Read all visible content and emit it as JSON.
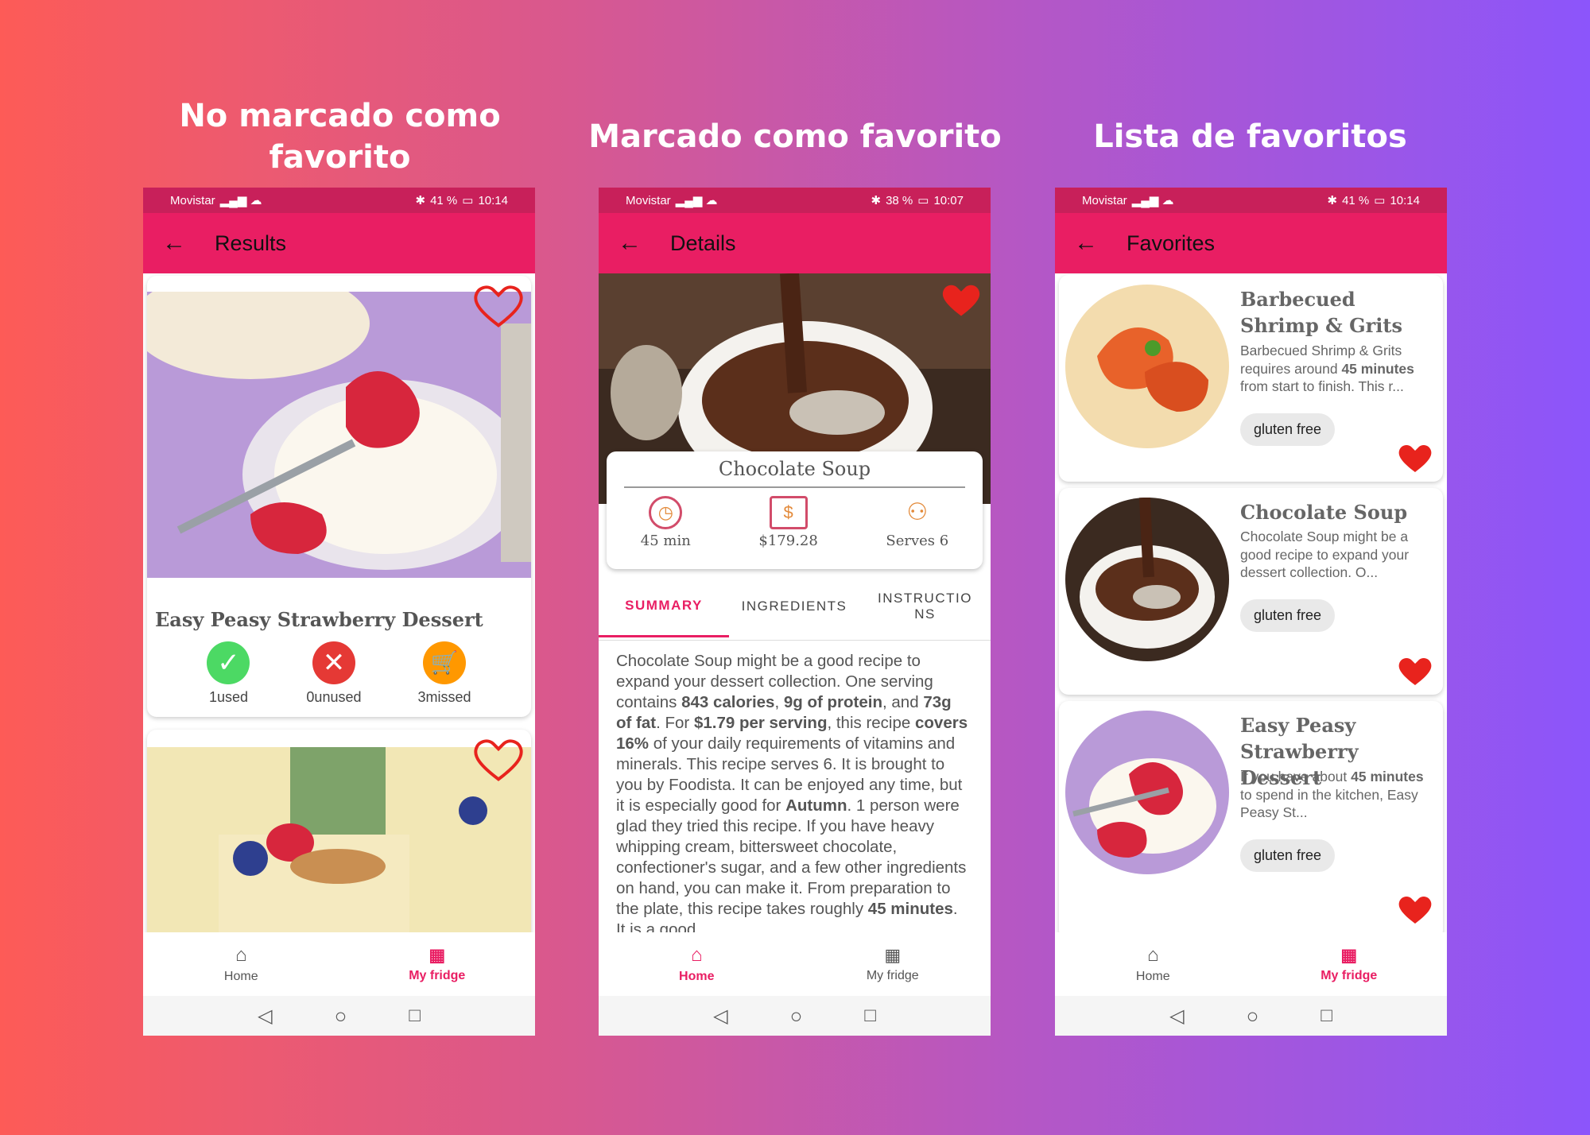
{
  "captions": [
    "No marcado como favorito",
    "Marcado como favorito",
    "Lista de favoritos"
  ],
  "status": [
    {
      "carrier": "Movistar",
      "battery": "41 %",
      "time": "10:14"
    },
    {
      "carrier": "Movistar",
      "battery": "38 %",
      "time": "10:07"
    },
    {
      "carrier": "Movistar",
      "battery": "41 %",
      "time": "10:14"
    }
  ],
  "results": {
    "title": "Results",
    "card_title": "Easy Peasy Strawberry Dessert",
    "used": "1used",
    "unused": "0unused",
    "missed": "3missed"
  },
  "details": {
    "title": "Details",
    "recipe_name": "Chocolate Soup",
    "time": "45 min",
    "price": "$179.28",
    "serves": "Serves 6",
    "tabs": [
      "SUMMARY",
      "INGREDIENTS",
      "INSTRUCTIONS"
    ],
    "summary_parts": [
      {
        "t": "Chocolate Soup might be a good recipe to expand your dessert collection. One serving contains ",
        "b": false
      },
      {
        "t": "843 calories",
        "b": true
      },
      {
        "t": ", ",
        "b": false
      },
      {
        "t": "9g of protein",
        "b": true
      },
      {
        "t": ", and ",
        "b": false
      },
      {
        "t": "73g of fat",
        "b": true
      },
      {
        "t": ". For ",
        "b": false
      },
      {
        "t": "$1.79 per serving",
        "b": true
      },
      {
        "t": ", this recipe ",
        "b": false
      },
      {
        "t": "covers 16%",
        "b": true
      },
      {
        "t": " of your daily requirements of vitamins and minerals. This recipe serves 6. It is brought to you by Foodista. It can be enjoyed any time, but it is especially good for ",
        "b": false
      },
      {
        "t": "Autumn",
        "b": true
      },
      {
        "t": ". 1 person were glad they tried this recipe. If you have heavy whipping cream, bittersweet chocolate, confectioner's sugar, and a few other ingredients on hand, you can make it. From preparation to the plate, this recipe takes roughly ",
        "b": false
      },
      {
        "t": "45 minutes",
        "b": true
      },
      {
        "t": ". It is a good",
        "b": false
      }
    ]
  },
  "favorites": {
    "title": "Favorites",
    "items": [
      {
        "name": "Barbecued Shrimp & Grits",
        "desc_parts": [
          {
            "t": "Barbecued Shrimp & Grits requires around ",
            "b": false
          },
          {
            "t": "45 minutes",
            "b": true
          },
          {
            "t": " from start to finish. This r...",
            "b": false
          }
        ],
        "tag": "gluten free"
      },
      {
        "name": "Chocolate Soup",
        "desc_parts": [
          {
            "t": "Chocolate Soup might be a good recipe to expand your dessert collection. O...",
            "b": false
          }
        ],
        "tag": "gluten free"
      },
      {
        "name": "Easy Peasy Strawberry Dessert",
        "desc_parts": [
          {
            "t": "If you have about ",
            "b": false
          },
          {
            "t": "45 minutes",
            "b": true
          },
          {
            "t": " to spend in the kitchen, Easy Peasy St...",
            "b": false
          }
        ],
        "tag": "gluten free"
      }
    ]
  },
  "nav": {
    "home": "Home",
    "fridge": "My fridge"
  },
  "colors": {
    "primary": "#e91e63",
    "status": "#c8205a",
    "heart": "#e8231d",
    "used": "#4cd964",
    "unused": "#e53935",
    "missed": "#ff9800"
  }
}
